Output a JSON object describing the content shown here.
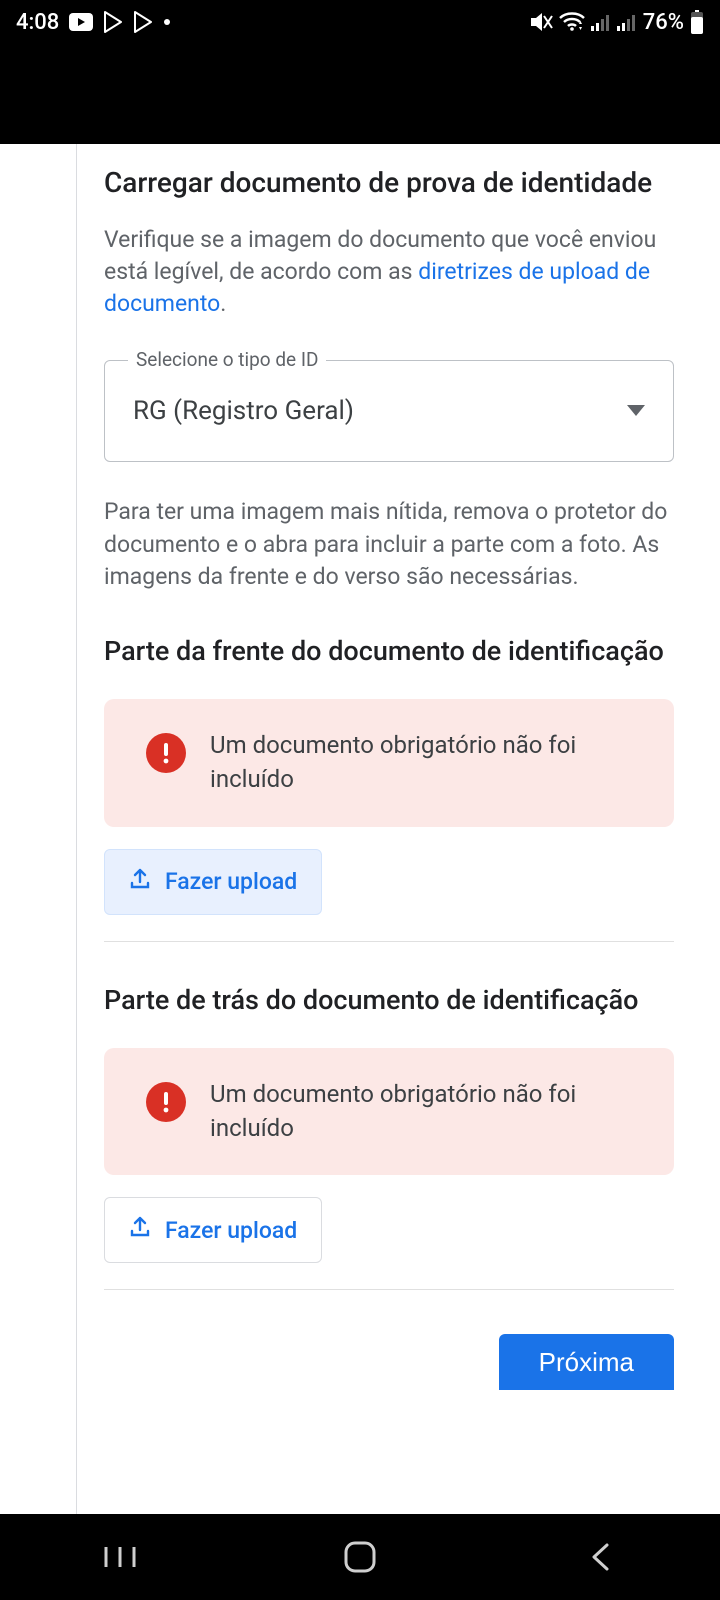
{
  "status_bar": {
    "time": "4:08",
    "battery_text": "76%"
  },
  "page": {
    "title": "Carregar documento de prova de identidade",
    "helper_prefix": "Verifique se a imagem do documento que você enviou está legível, de acordo com as ",
    "helper_link": "diretrizes de upload de documento",
    "helper_suffix": "."
  },
  "select": {
    "legend": "Selecione o tipo de ID",
    "value": "RG (Registro Geral)"
  },
  "hint": "Para ter uma imagem mais nítida, remova o protetor do documento e o abra para incluir a parte com a foto. As imagens da frente e do verso são necessárias.",
  "sections": {
    "front": {
      "title": "Parte da frente do documento de identificação",
      "error": "Um documento obrigatório não foi incluído",
      "upload_label": "Fazer upload"
    },
    "back": {
      "title": "Parte de trás do documento de identificação",
      "error": "Um documento obrigatório não foi incluído",
      "upload_label": "Fazer upload"
    }
  },
  "next_label": "Próxima"
}
